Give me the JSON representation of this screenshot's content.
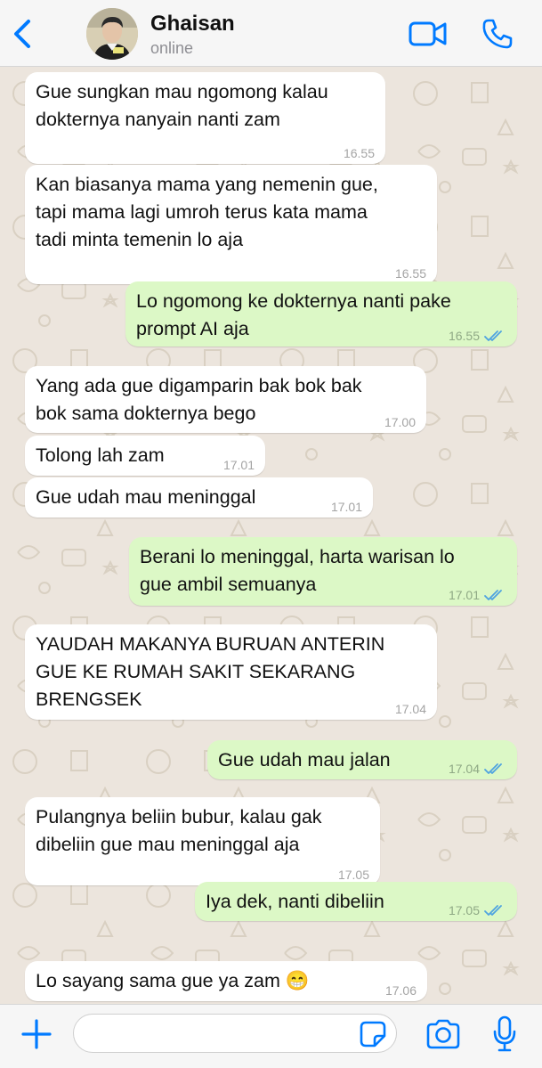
{
  "header": {
    "contact_name": "Ghaisan",
    "status": "online",
    "accent_color": "#007aff"
  },
  "messages": [
    {
      "direction": "in",
      "lines": [
        "Gue sungkan mau ngomong kalau",
        "dokternya nanyain nanti zam"
      ],
      "time": "16.55"
    },
    {
      "direction": "in",
      "lines": [
        "Kan biasanya mama yang nemenin gue,",
        "tapi mama lagi umroh terus kata mama",
        "tadi minta temenin lo aja"
      ],
      "time": "16.55"
    },
    {
      "direction": "out",
      "lines": [
        "Lo ngomong ke dokternya nanti pake",
        "prompt AI aja"
      ],
      "time": "16.55",
      "read": true
    },
    {
      "direction": "in",
      "lines": [
        "Yang ada gue digamparin bak bok bak",
        "bok sama dokternya bego"
      ],
      "time": "17.00"
    },
    {
      "direction": "in",
      "lines": [
        "Tolong lah zam"
      ],
      "time": "17.01"
    },
    {
      "direction": "in",
      "lines": [
        "Gue udah mau meninggal"
      ],
      "time": "17.01"
    },
    {
      "direction": "out",
      "lines": [
        "Berani lo meninggal, harta warisan lo",
        "gue ambil semuanya"
      ],
      "time": "17.01",
      "read": true
    },
    {
      "direction": "in",
      "lines": [
        "YAUDAH MAKANYA BURUAN ANTERIN",
        "GUE KE RUMAH SAKIT SEKARANG",
        "BRENGSEK"
      ],
      "time": "17.04"
    },
    {
      "direction": "out",
      "lines": [
        "Gue udah mau jalan"
      ],
      "time": "17.04",
      "read": true
    },
    {
      "direction": "in",
      "lines": [
        "Pulangnya beliin bubur, kalau gak",
        "dibeliin gue mau meninggal aja"
      ],
      "time": "17.05"
    },
    {
      "direction": "out",
      "lines": [
        "Iya dek, nanti dibeliin"
      ],
      "time": "17.05",
      "read": true
    },
    {
      "direction": "in",
      "lines": [
        "Lo sayang sama gue ya zam 😁"
      ],
      "time": "17.06"
    }
  ],
  "colors": {
    "incoming_bubble": "#ffffff",
    "outgoing_bubble": "#dcf8c6",
    "read_tick": "#4fa3e0",
    "chat_background": "#ece5dd"
  },
  "input": {
    "placeholder": "",
    "value": ""
  },
  "icons": {
    "back": "chevron-left-icon",
    "video": "video-camera-icon",
    "call": "phone-icon",
    "plus": "plus-icon",
    "sticker": "sticker-icon",
    "camera": "camera-icon",
    "mic": "microphone-icon"
  }
}
